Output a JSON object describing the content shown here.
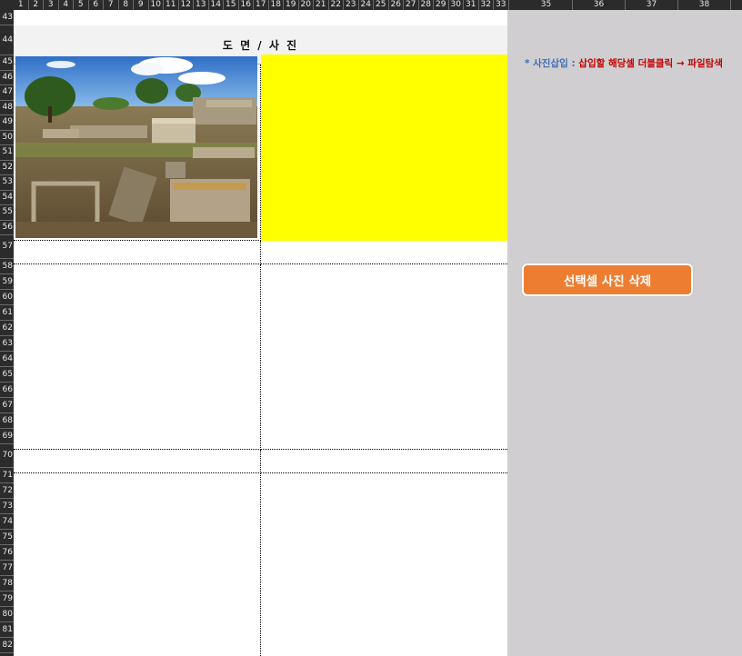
{
  "column_headers": [
    "1",
    "2",
    "3",
    "4",
    "5",
    "6",
    "7",
    "8",
    "9",
    "10",
    "11",
    "12",
    "13",
    "14",
    "15",
    "16",
    "17",
    "18",
    "19",
    "20",
    "21",
    "22",
    "23",
    "24",
    "25",
    "26",
    "27",
    "28",
    "29",
    "30",
    "31",
    "32",
    "33",
    "35",
    "36",
    "37",
    "38"
  ],
  "row_headers": [
    "43",
    "44",
    "45",
    "46",
    "47",
    "48",
    "49",
    "50",
    "51",
    "52",
    "53",
    "54",
    "55",
    "56",
    "57",
    "58",
    "59",
    "60",
    "61",
    "62",
    "63",
    "64",
    "65",
    "66",
    "67",
    "68",
    "69",
    "70",
    "71",
    "72",
    "73",
    "74",
    "75",
    "76",
    "77",
    "78",
    "79",
    "80",
    "81",
    "82"
  ],
  "sheet": {
    "title": "도 면 / 사 진"
  },
  "panel": {
    "hint_prefix": "* 사진삽입 :",
    "hint_text": " 삽입할 해당셀 더블클릭 → 파일탐색",
    "delete_button_label": "선택셀 사진 삭제"
  },
  "colors": {
    "yellow_cell": "#ffff00",
    "button": "#ed7d31",
    "panel_bg": "#d0ced0",
    "hint_blue": "#3f6fb6",
    "hint_red": "#c00000"
  }
}
